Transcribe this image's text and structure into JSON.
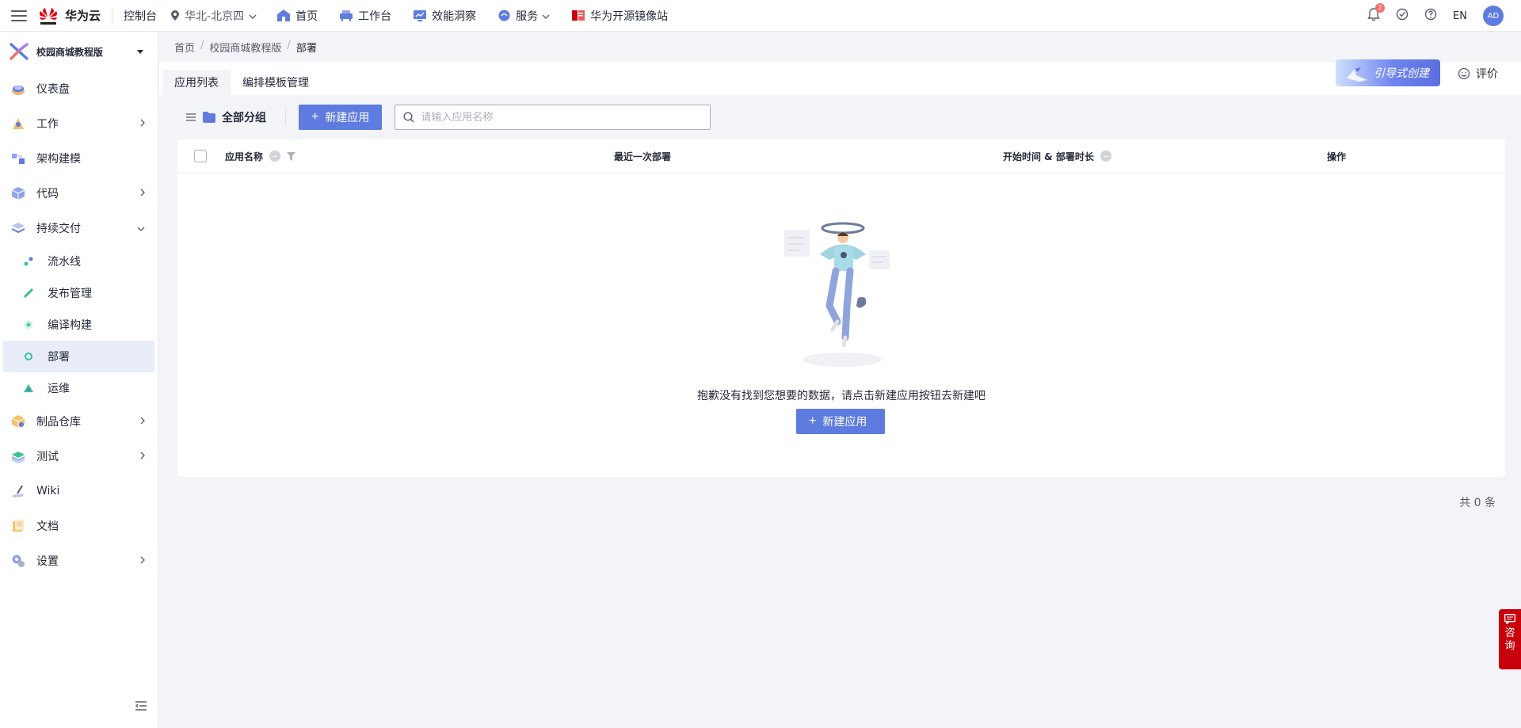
{
  "topbar": {
    "brand": "华为云",
    "console": "控制台",
    "region": "华北-北京四",
    "nav": [
      {
        "label": "首页",
        "icon": "home-icon"
      },
      {
        "label": "工作台",
        "icon": "workbench-icon"
      },
      {
        "label": "效能洞察",
        "icon": "insight-icon"
      },
      {
        "label": "服务",
        "icon": "service-icon"
      },
      {
        "label": "华为开源镜像站",
        "icon": "mirror-icon"
      }
    ],
    "notification_count": "2",
    "lang": "EN",
    "avatar": "AD"
  },
  "sidebar": {
    "project": "校园商城教程版",
    "items": [
      {
        "label": "仪表盘",
        "icon": "dashboard-icon",
        "has_arrow": false
      },
      {
        "label": "工作",
        "icon": "work-icon",
        "has_arrow": true
      },
      {
        "label": "架构建模",
        "icon": "architecture-icon",
        "has_arrow": false
      },
      {
        "label": "代码",
        "icon": "code-icon",
        "has_arrow": true
      },
      {
        "label": "持续交付",
        "icon": "delivery-icon",
        "has_arrow": true,
        "expanded": true
      }
    ],
    "sub_items": [
      {
        "label": "流水线",
        "icon": "pipeline-icon"
      },
      {
        "label": "发布管理",
        "icon": "release-icon"
      },
      {
        "label": "编译构建",
        "icon": "build-icon"
      },
      {
        "label": "部署",
        "icon": "deploy-icon",
        "active": true
      },
      {
        "label": "运维",
        "icon": "ops-icon"
      }
    ],
    "items_after": [
      {
        "label": "制品仓库",
        "icon": "artifact-icon",
        "has_arrow": true
      },
      {
        "label": "测试",
        "icon": "test-icon",
        "has_arrow": true
      },
      {
        "label": "Wiki",
        "icon": "wiki-icon",
        "has_arrow": false
      },
      {
        "label": "文档",
        "icon": "docs-icon",
        "has_arrow": false
      },
      {
        "label": "设置",
        "icon": "settings-icon",
        "has_arrow": true
      }
    ]
  },
  "breadcrumb": [
    "首页",
    "校园商城教程版",
    "部署"
  ],
  "tabs": [
    "应用列表",
    "编排模板管理"
  ],
  "guide_button": "引导式创建",
  "rate": "评价",
  "toolbar": {
    "group": "全部分组",
    "new_app": "新建应用",
    "search_placeholder": "请输入应用名称"
  },
  "table": {
    "columns": [
      "应用名称",
      "最近一次部署",
      "开始时间 & 部署时长",
      "操作"
    ],
    "rows": []
  },
  "empty": {
    "message": "抱歉没有找到您想要的数据，请点击新建应用按钮去新建吧",
    "button": "新建应用"
  },
  "total": "共 0 条",
  "consult": [
    "咨",
    "询"
  ],
  "colors": {
    "primary": "#5e7ce0",
    "brand_red": "#c7000b",
    "active_bg": "#e9edfa"
  }
}
